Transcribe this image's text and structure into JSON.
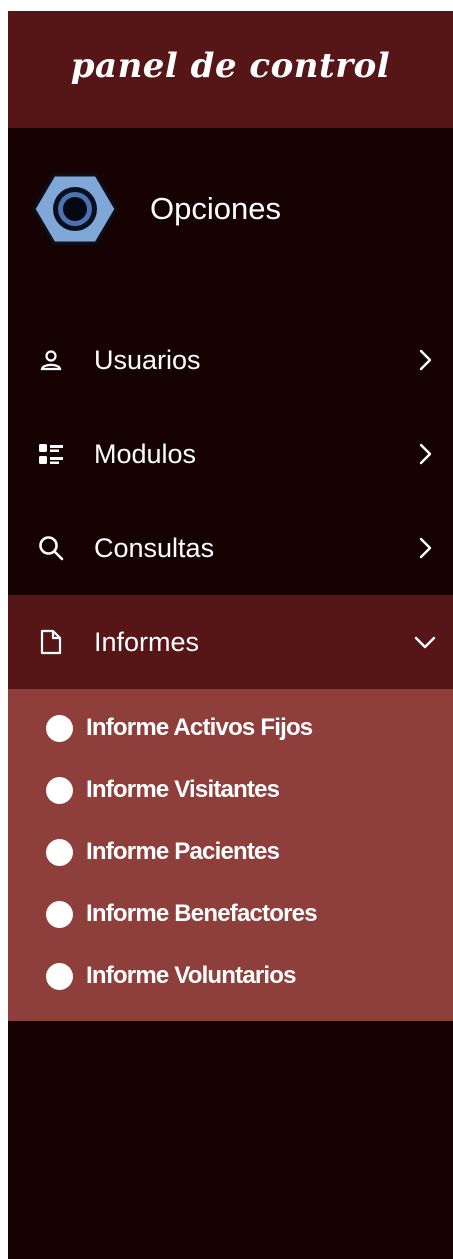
{
  "header": {
    "title": "panel de control"
  },
  "brand": {
    "label": "Opciones",
    "icon": "hexagon-nut-icon"
  },
  "menu": {
    "items": [
      {
        "label": "Usuarios",
        "icon": "user-icon",
        "expanded": false
      },
      {
        "label": "Modulos",
        "icon": "checklist-icon",
        "expanded": false
      },
      {
        "label": "Consultas",
        "icon": "search-icon",
        "expanded": false
      },
      {
        "label": "Informes",
        "icon": "document-icon",
        "expanded": true
      }
    ],
    "submenu": [
      {
        "label": "Informe Activos Fijos"
      },
      {
        "label": "Informe Visitantes"
      },
      {
        "label": "Informe Pacientes"
      },
      {
        "label": "Informe Benefactores"
      },
      {
        "label": "Informe Voluntarios"
      }
    ]
  },
  "colors": {
    "sidebar_bg": "#160203",
    "header_bg": "#561517",
    "active_bg": "#561517",
    "submenu_bg": "#8f3f3b",
    "logo_blue": "#7fa8d8"
  }
}
